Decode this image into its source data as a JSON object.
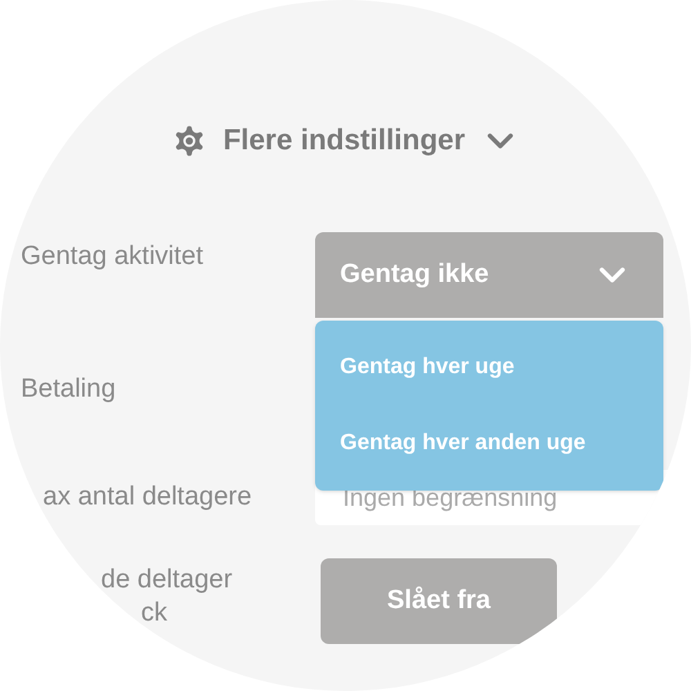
{
  "section_toggle": {
    "label": "Flere indstillinger",
    "expanded": true
  },
  "rows": [
    {
      "kind": "select",
      "label": "Gentag aktivitet",
      "value": "Gentag ikke",
      "open": true,
      "options": [
        "Gentag hver uge",
        "Gentag hver anden uge"
      ]
    },
    {
      "kind": "hidden",
      "label": "Betaling"
    },
    {
      "kind": "input",
      "label": "ax antal deltagere",
      "placeholder": "Ingen begrænsning"
    },
    {
      "kind": "toggle",
      "label_lines": [
        "de deltager",
        "ck"
      ],
      "value": "Slået fra",
      "on": false
    }
  ]
}
